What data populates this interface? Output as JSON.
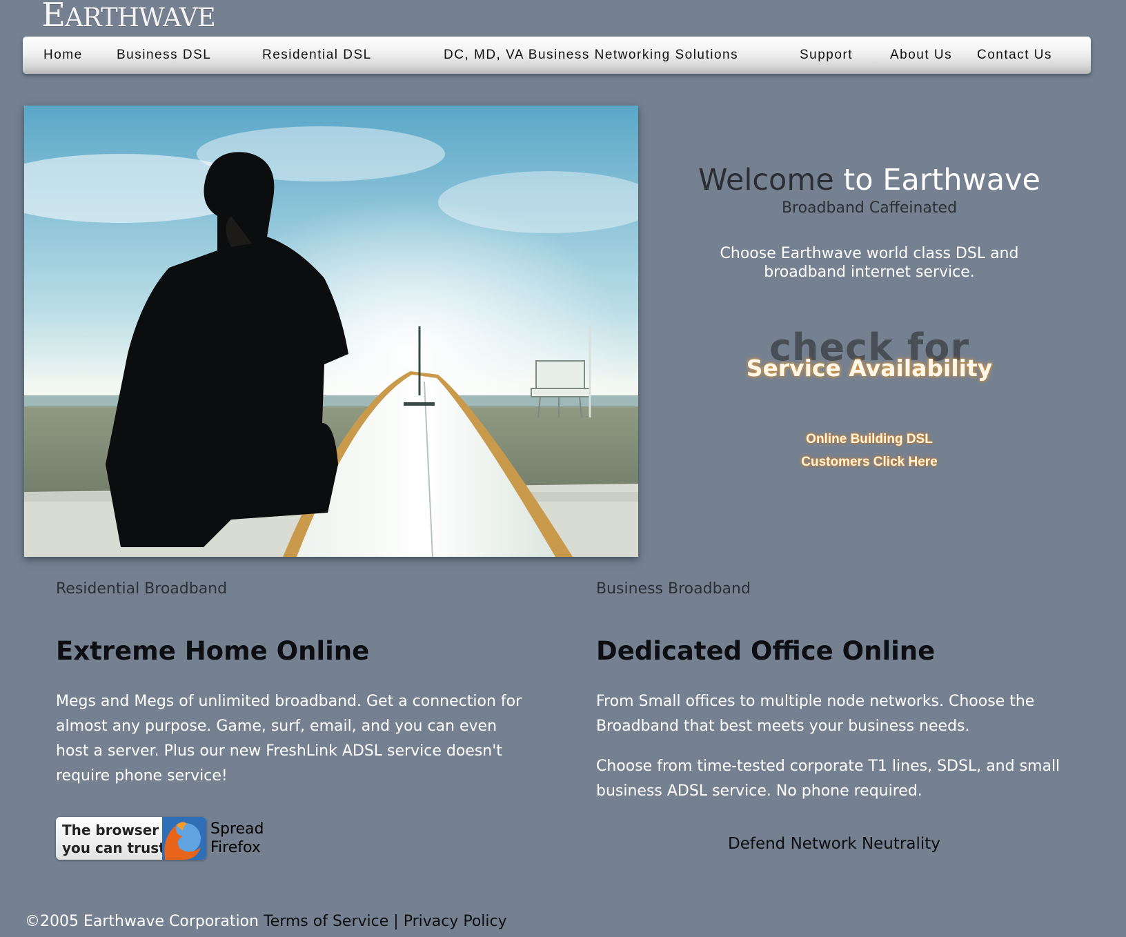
{
  "brand": {
    "logo_text": "EARTHWAVE",
    "logo_first": "E",
    "logo_rest": "ARTHWAVE"
  },
  "nav": {
    "items": [
      {
        "label": "Home"
      },
      {
        "label": "Business DSL"
      },
      {
        "label": "Residential DSL"
      },
      {
        "label": "DC, MD, VA Business Networking Solutions"
      },
      {
        "label": "Support"
      },
      {
        "label": "About Us"
      },
      {
        "label": "Contact Us"
      }
    ]
  },
  "welcome": {
    "title_part1": "Welcome",
    "title_part2": "to Earthwave",
    "tagline": "Broadband Caffeinated",
    "description": "Choose Earthwave world class DSL and broadband internet service."
  },
  "availability": {
    "line1": "check for",
    "line2": "Service Availability"
  },
  "building_dsl": {
    "line1": "Online Building DSL",
    "line2": "Customers Click Here"
  },
  "residential": {
    "label": "Residential Broadband",
    "heading": "Extreme Home Online",
    "body": "Megs and Megs of unlimited broadband. Get a connection for almost any purpose. Game, surf, email, and you can even host a server. Plus our new FreshLink ADSL service doesn't require phone service!"
  },
  "business": {
    "label": "Business Broadband",
    "heading": "Dedicated Office Online",
    "body1": "From Small offices to multiple node networks. Choose the Broadband that best meets your business needs.",
    "body2": "Choose from time-tested corporate T1 lines, SDSL, and small business ADSL service. No phone required."
  },
  "firefox": {
    "badge_line1": "The browser",
    "badge_line2": "you can trust",
    "spread_line1": "Spread",
    "spread_line2": "Firefox"
  },
  "neutrality_link": "Defend Network Neutrality",
  "footer": {
    "copyright": "©2005 Earthwave Corporation",
    "terms": "Terms of Service",
    "separator": "|",
    "privacy": "Privacy Policy"
  },
  "colors": {
    "background": "#758190",
    "dark_text": "#2b2f35",
    "glow_orange": "#e08a28"
  }
}
